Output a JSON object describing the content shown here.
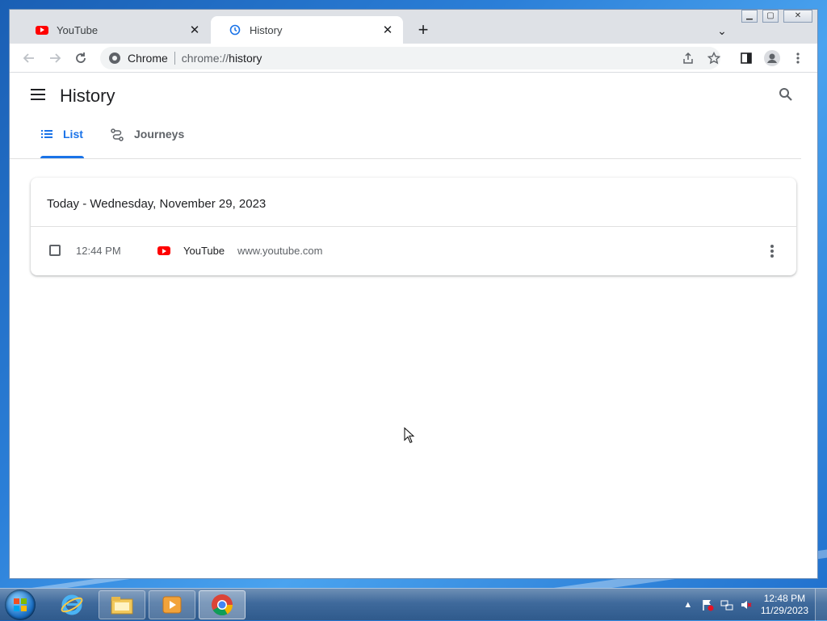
{
  "browser": {
    "tabs": [
      {
        "title": "YouTube",
        "icon": "youtube-icon",
        "active": false
      },
      {
        "title": "History",
        "icon": "history-icon",
        "active": true
      }
    ],
    "omnibox": {
      "prefix": "Chrome",
      "scheme": "chrome://",
      "path": "history"
    }
  },
  "history": {
    "title": "History",
    "tabs": [
      {
        "label": "List",
        "active": true
      },
      {
        "label": "Journeys",
        "active": false
      }
    ],
    "day_header": "Today - Wednesday, November 29, 2023",
    "entries": [
      {
        "time": "12:44 PM",
        "title": "YouTube",
        "domain": "www.youtube.com",
        "icon": "youtube-icon"
      }
    ]
  },
  "taskbar": {
    "clock_time": "12:48 PM",
    "clock_date": "11/29/2023"
  },
  "colors": {
    "accent": "#1a73e8",
    "youtube_red": "#ff0000"
  }
}
